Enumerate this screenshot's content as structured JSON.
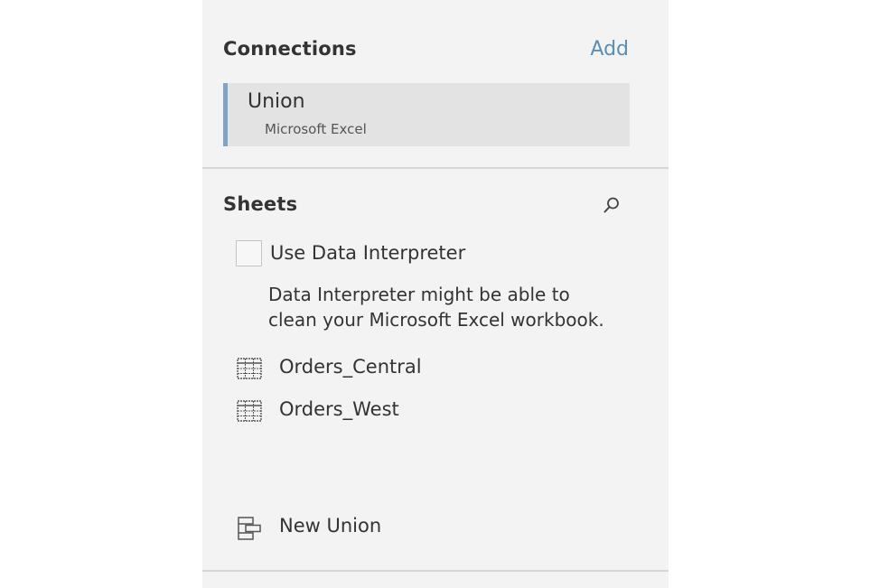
{
  "connections": {
    "title": "Connections",
    "add_label": "Add",
    "items": [
      {
        "name": "Union",
        "type": "Microsoft Excel"
      }
    ]
  },
  "sheets": {
    "title": "Sheets",
    "search_icon": "search-icon",
    "data_interpreter": {
      "label": "Use Data Interpreter",
      "checked": false,
      "hint_line1": "Data Interpreter might be able to",
      "hint_line2": "clean your Microsoft Excel workbook."
    },
    "items": [
      {
        "label": "Orders_Central",
        "icon": "table-icon"
      },
      {
        "label": "Orders_West",
        "icon": "table-icon"
      }
    ],
    "new_union": {
      "label": "New Union",
      "icon": "union-icon"
    }
  },
  "colors": {
    "panel_background": "#f3f3f3",
    "accent": "#5b8db5",
    "selected_bar": "#7fa4c7",
    "selected_background": "#e3e3e3"
  }
}
